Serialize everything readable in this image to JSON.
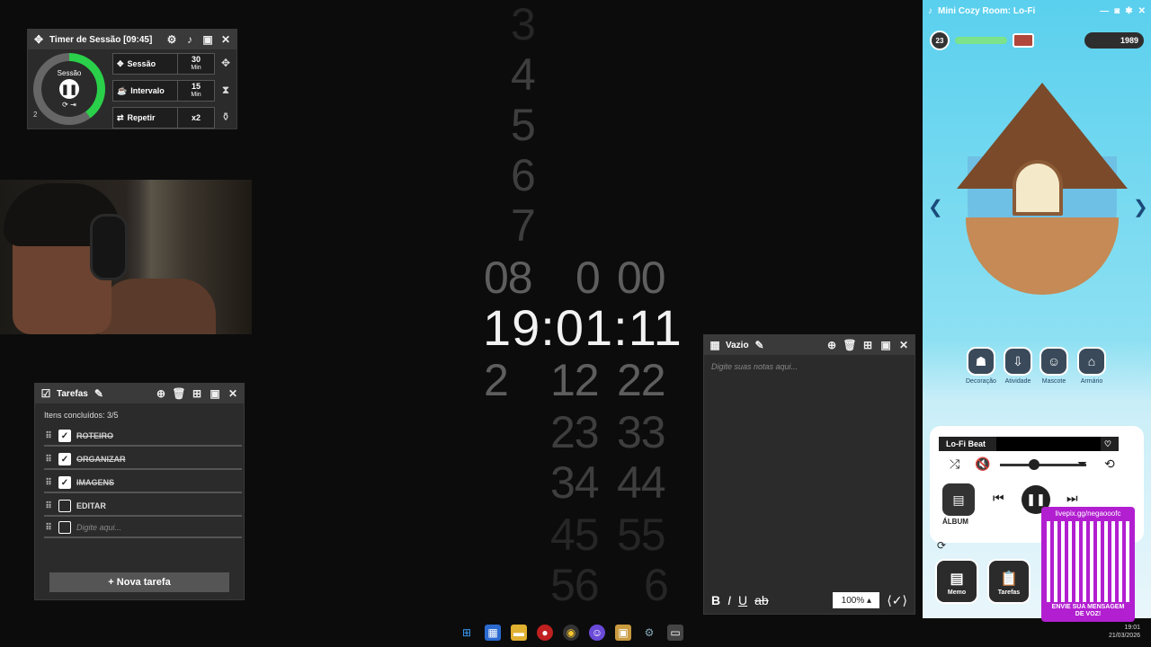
{
  "timer": {
    "title": "Timer de Sessão [09:45]",
    "ring_label": "Sessão",
    "ring_progress": 0.4,
    "count": "2",
    "rows": [
      {
        "label": "Sessão",
        "value": "30",
        "unit": "Min"
      },
      {
        "label": "Intervalo",
        "value": "15",
        "unit": "Min"
      },
      {
        "label": "Repetir",
        "value": "x2",
        "unit": ""
      }
    ]
  },
  "tasks": {
    "title": "Tarefas",
    "summary": "Itens concluídos: 3/5",
    "items": [
      {
        "text": "ROTEIRO",
        "done": true
      },
      {
        "text": "ORGANIZAR",
        "done": true
      },
      {
        "text": "IMAGENS",
        "done": true
      },
      {
        "text": "EDITAR",
        "done": false
      }
    ],
    "input_placeholder": "Digite aqui...",
    "new_task_label": "+ Nova tarefa"
  },
  "clock": {
    "time": "19:01:11",
    "col1": [
      "3",
      "4",
      "5",
      "6",
      "7",
      "08",
      "2"
    ],
    "col2_above": "0",
    "col2_below": [
      "12",
      "23",
      "34",
      "45",
      "56"
    ],
    "col3_above": "00",
    "col3_below": [
      "22",
      "33",
      "44",
      "55",
      "6"
    ]
  },
  "notes": {
    "title": "Vazio",
    "placeholder": "Digite suas notas aqui...",
    "zoom": "100%"
  },
  "cozy": {
    "title": "Mini Cozy Room: Lo-Fi",
    "level": "23",
    "coins": "1989",
    "menu": [
      "Decoração",
      "Atividade",
      "Mascote",
      "Armário"
    ],
    "track": "Lo-Fi Beat",
    "album_label": "ÁLBUM",
    "memo_label": "Memo",
    "tasks_label": "Tarefas"
  },
  "qr": {
    "header": "livepix.gg/negaooofc",
    "footer_line1": "ENVIE SUA MENSAGEM",
    "footer_line2": "DE VOZ!"
  },
  "system": {
    "time": "19:01",
    "date": "21/03/2026"
  }
}
